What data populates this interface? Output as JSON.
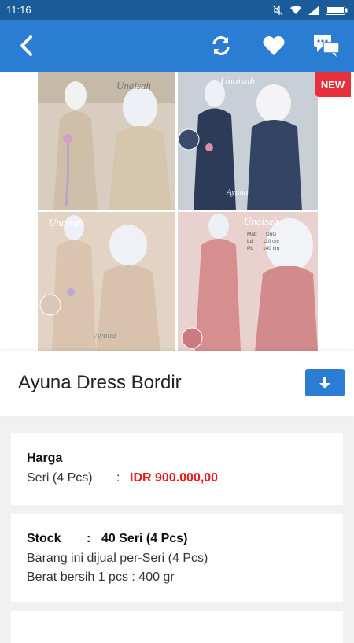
{
  "status": {
    "time": "11:16"
  },
  "header": {
    "back_icon": "chevron-left-icon",
    "refresh_icon": "refresh-icon",
    "favorite_icon": "heart-icon",
    "chat_icon": "chat-icon"
  },
  "product": {
    "badge": "NEW",
    "title": "Ayuna Dress Bordir",
    "image_labels": {
      "brand": "Unaisah",
      "name": "Ayuna",
      "spec_matt": "Matt",
      "spec_dng": "DnG",
      "spec_ld": "Ld",
      "spec_ld_val": "110 cm",
      "spec_pb": "Pb",
      "spec_pb_val": "140 cm"
    }
  },
  "pricing": {
    "heading": "Harga",
    "unit_label": "Seri (4 Pcs)",
    "separator": ":",
    "price": "IDR 900.000,00"
  },
  "stock": {
    "label": "Stock",
    "separator": ":",
    "value": "40 Seri (4 Pcs)",
    "note1": "Barang ini dijual per-Seri (4 Pcs)",
    "note2": "Berat bersih 1 pcs : 400 gr"
  },
  "colors": {
    "primary": "#2a7dd2",
    "statusbar": "#1a5c9a",
    "price": "#e81c1c",
    "badge": "#e8303a"
  }
}
